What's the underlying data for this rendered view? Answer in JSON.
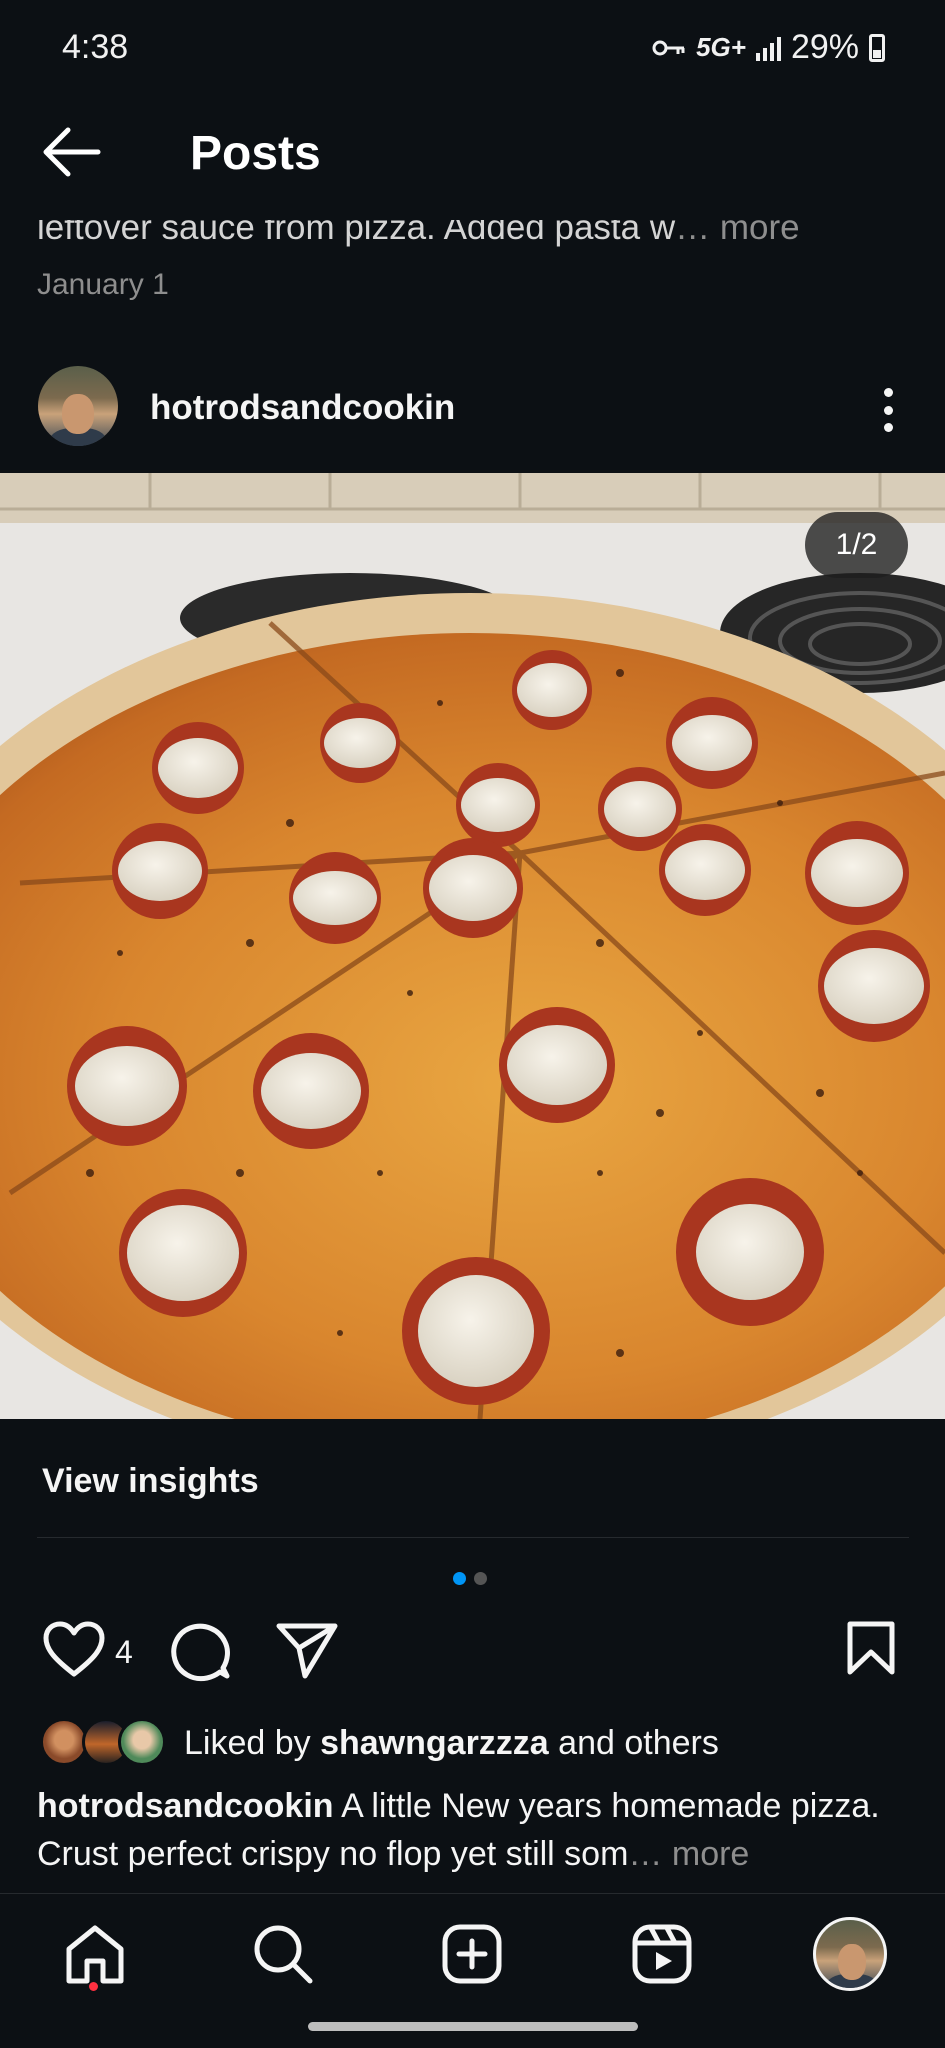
{
  "status_bar": {
    "time": "4:38",
    "network": "5G+",
    "battery": "29%"
  },
  "header": {
    "title": "Posts"
  },
  "previous_post": {
    "caption_text": "leftover sauce from pizza. Added pasta w",
    "ellipsis": "…",
    "more_label": "more",
    "date": "January 1"
  },
  "post": {
    "username": "hotrodsandcookin",
    "photo_counter": "1/2",
    "photo_description_icon": "pizza-photo",
    "view_insights_label": "View insights",
    "carousel": {
      "count": 2,
      "active_index": 0
    },
    "like_count": "4",
    "liked_by_prefix": "Liked by ",
    "liked_by_user": "shawngarzzza",
    "liked_by_suffix": " and others",
    "caption_username": "hotrodsandcookin",
    "caption_text": " A little New years homemade pizza. Crust perfect crispy no flop yet still som",
    "caption_ellipsis": "…",
    "caption_more": " more"
  },
  "nav": {
    "items": [
      "home-icon",
      "search-icon",
      "create-icon",
      "reels-icon",
      "profile-avatar"
    ]
  },
  "colors": {
    "background": "#0c1014",
    "text": "#f5f5f5",
    "muted": "#8e8e8e",
    "accent_dot": "#0095f6",
    "notification_dot": "#ff3040"
  }
}
